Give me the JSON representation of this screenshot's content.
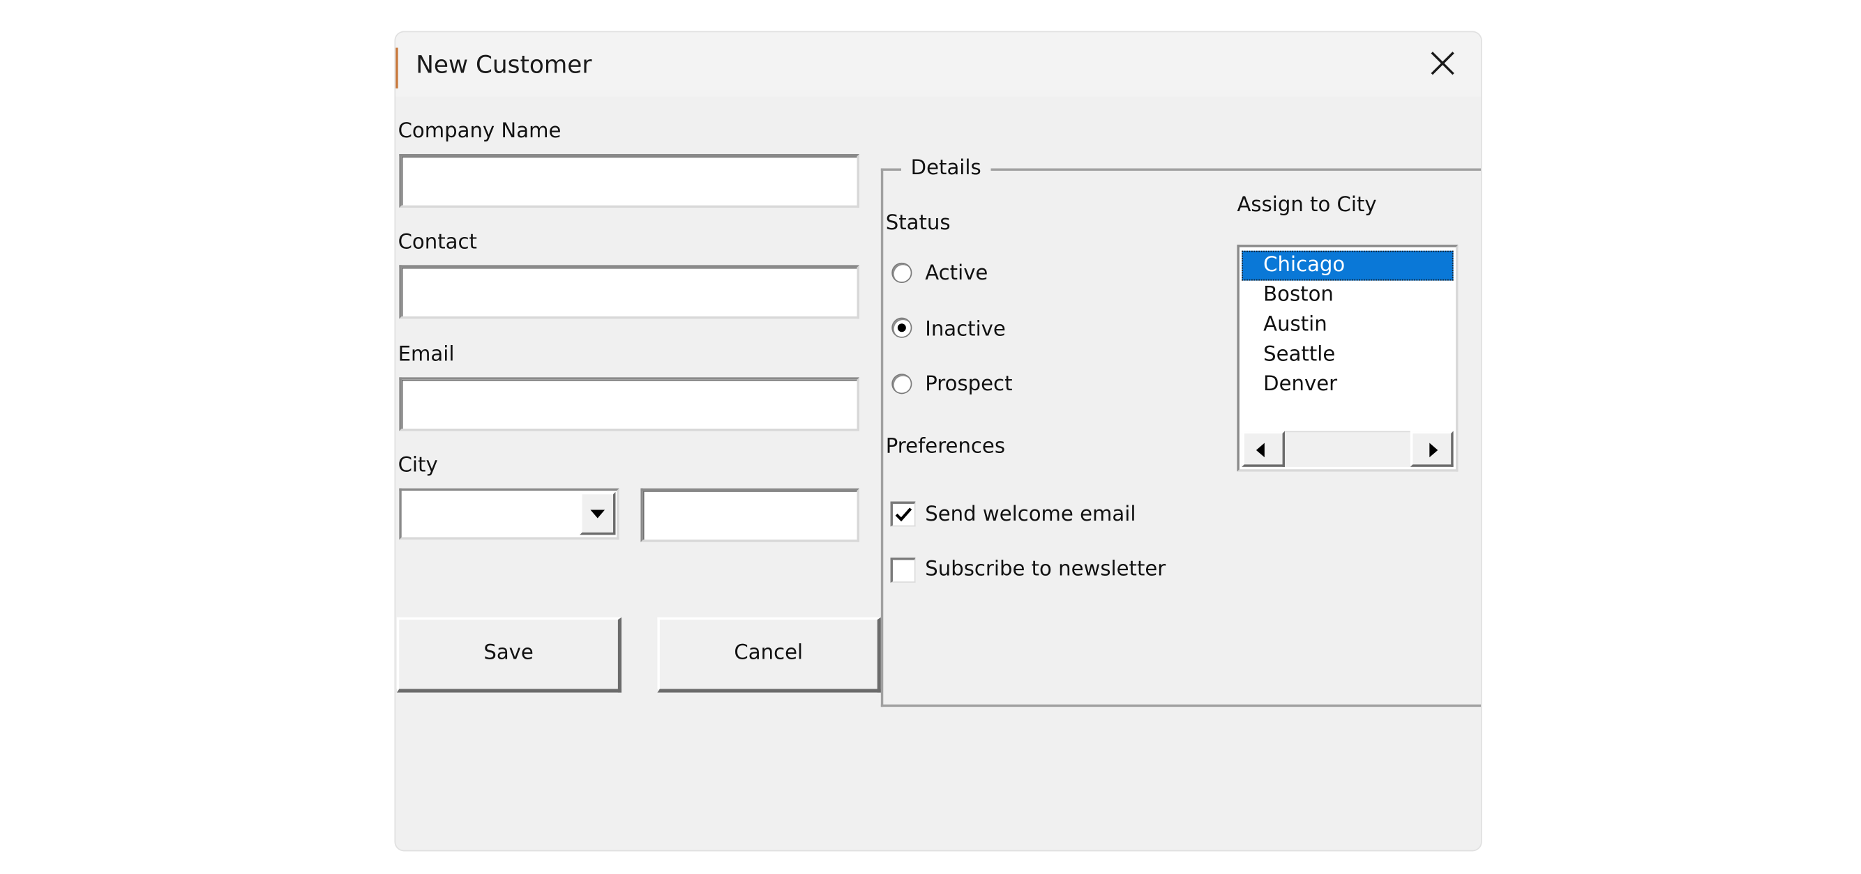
{
  "window": {
    "title": "New Customer",
    "close_icon": "close-icon"
  },
  "form": {
    "company_label": "Company Name",
    "company_value": "",
    "contact_label": "Contact",
    "contact_value": "",
    "email_label": "Email",
    "email_value": "",
    "city_label": "City",
    "city_combo_value": "",
    "city_text_value": ""
  },
  "buttons": {
    "save_label": "Save",
    "cancel_label": "Cancel"
  },
  "details": {
    "legend": "Details",
    "status_label": "Status",
    "status_options": [
      {
        "label": "Active",
        "selected": false
      },
      {
        "label": "Inactive",
        "selected": true
      },
      {
        "label": "Prospect",
        "selected": false
      }
    ],
    "preferences_label": "Preferences",
    "preferences": [
      {
        "label": "Send welcome email",
        "checked": true
      },
      {
        "label": "Subscribe to newsletter",
        "checked": false
      }
    ],
    "assign_label": "Assign to City",
    "cities": [
      {
        "label": "Chicago",
        "selected": true
      },
      {
        "label": "Boston",
        "selected": false
      },
      {
        "label": "Austin",
        "selected": false
      },
      {
        "label": "Seattle",
        "selected": false
      },
      {
        "label": "Denver",
        "selected": false
      }
    ]
  },
  "colors": {
    "dialog_bg": "#f0f0f0",
    "selection": "#0a78d7",
    "accent": "#c8773a"
  }
}
